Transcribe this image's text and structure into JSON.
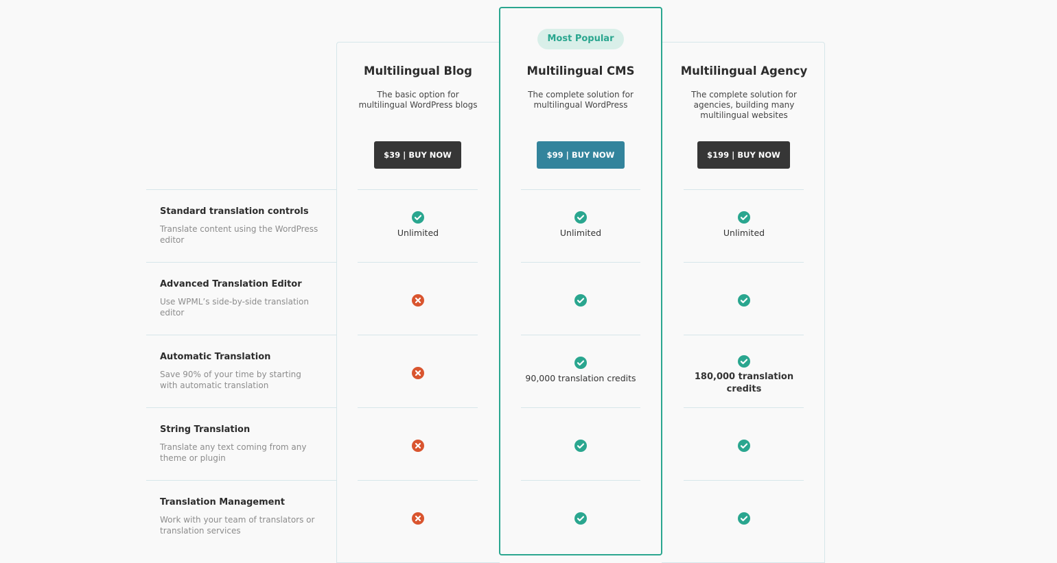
{
  "badge": "Most Popular",
  "plans": [
    {
      "name": "Multilingual Blog",
      "description_lines": [
        "The basic option for",
        "multilingual WordPress blogs"
      ],
      "button": "$39 | BUY NOW"
    },
    {
      "name": "Multilingual CMS",
      "description_lines": [
        "The complete solution for",
        "multilingual WordPress"
      ],
      "button": "$99 | BUY NOW"
    },
    {
      "name": "Multilingual Agency",
      "description_lines": [
        "The complete solution for",
        "agencies, building many",
        "multilingual websites"
      ],
      "button": "$199 | BUY NOW"
    }
  ],
  "features": [
    {
      "title": "Standard translation controls",
      "description_lines": [
        "Translate content using the WordPress",
        "editor"
      ],
      "values": [
        {
          "icon": "check",
          "text": "Unlimited"
        },
        {
          "icon": "check",
          "text": "Unlimited"
        },
        {
          "icon": "check",
          "text": "Unlimited"
        }
      ]
    },
    {
      "title": "Advanced Translation Editor",
      "description_lines": [
        "Use WPML’s side-by-side translation",
        "editor"
      ],
      "values": [
        {
          "icon": "cross"
        },
        {
          "icon": "check"
        },
        {
          "icon": "check"
        }
      ]
    },
    {
      "title": "Automatic Translation",
      "description_lines": [
        "Save 90% of your time by starting",
        "with automatic translation"
      ],
      "values": [
        {
          "icon": "cross"
        },
        {
          "icon": "check",
          "text": "90,000 translation credits"
        },
        {
          "icon": "check",
          "text_lines": [
            "180,000 translation",
            "credits"
          ]
        }
      ]
    },
    {
      "title": "String Translation",
      "description_lines": [
        "Translate any text coming from any",
        "theme or plugin"
      ],
      "values": [
        {
          "icon": "cross"
        },
        {
          "icon": "check"
        },
        {
          "icon": "check"
        }
      ]
    },
    {
      "title": "Translation Management",
      "description_lines": [
        "Work with your team of translators or",
        "translation services"
      ],
      "values": [
        {
          "icon": "cross"
        },
        {
          "icon": "check"
        },
        {
          "icon": "check"
        }
      ]
    }
  ],
  "colors": {
    "accent": "#2aa68f",
    "cross": "#d9552f",
    "cta_primary": "#33849c",
    "cta_dark": "#363636"
  }
}
